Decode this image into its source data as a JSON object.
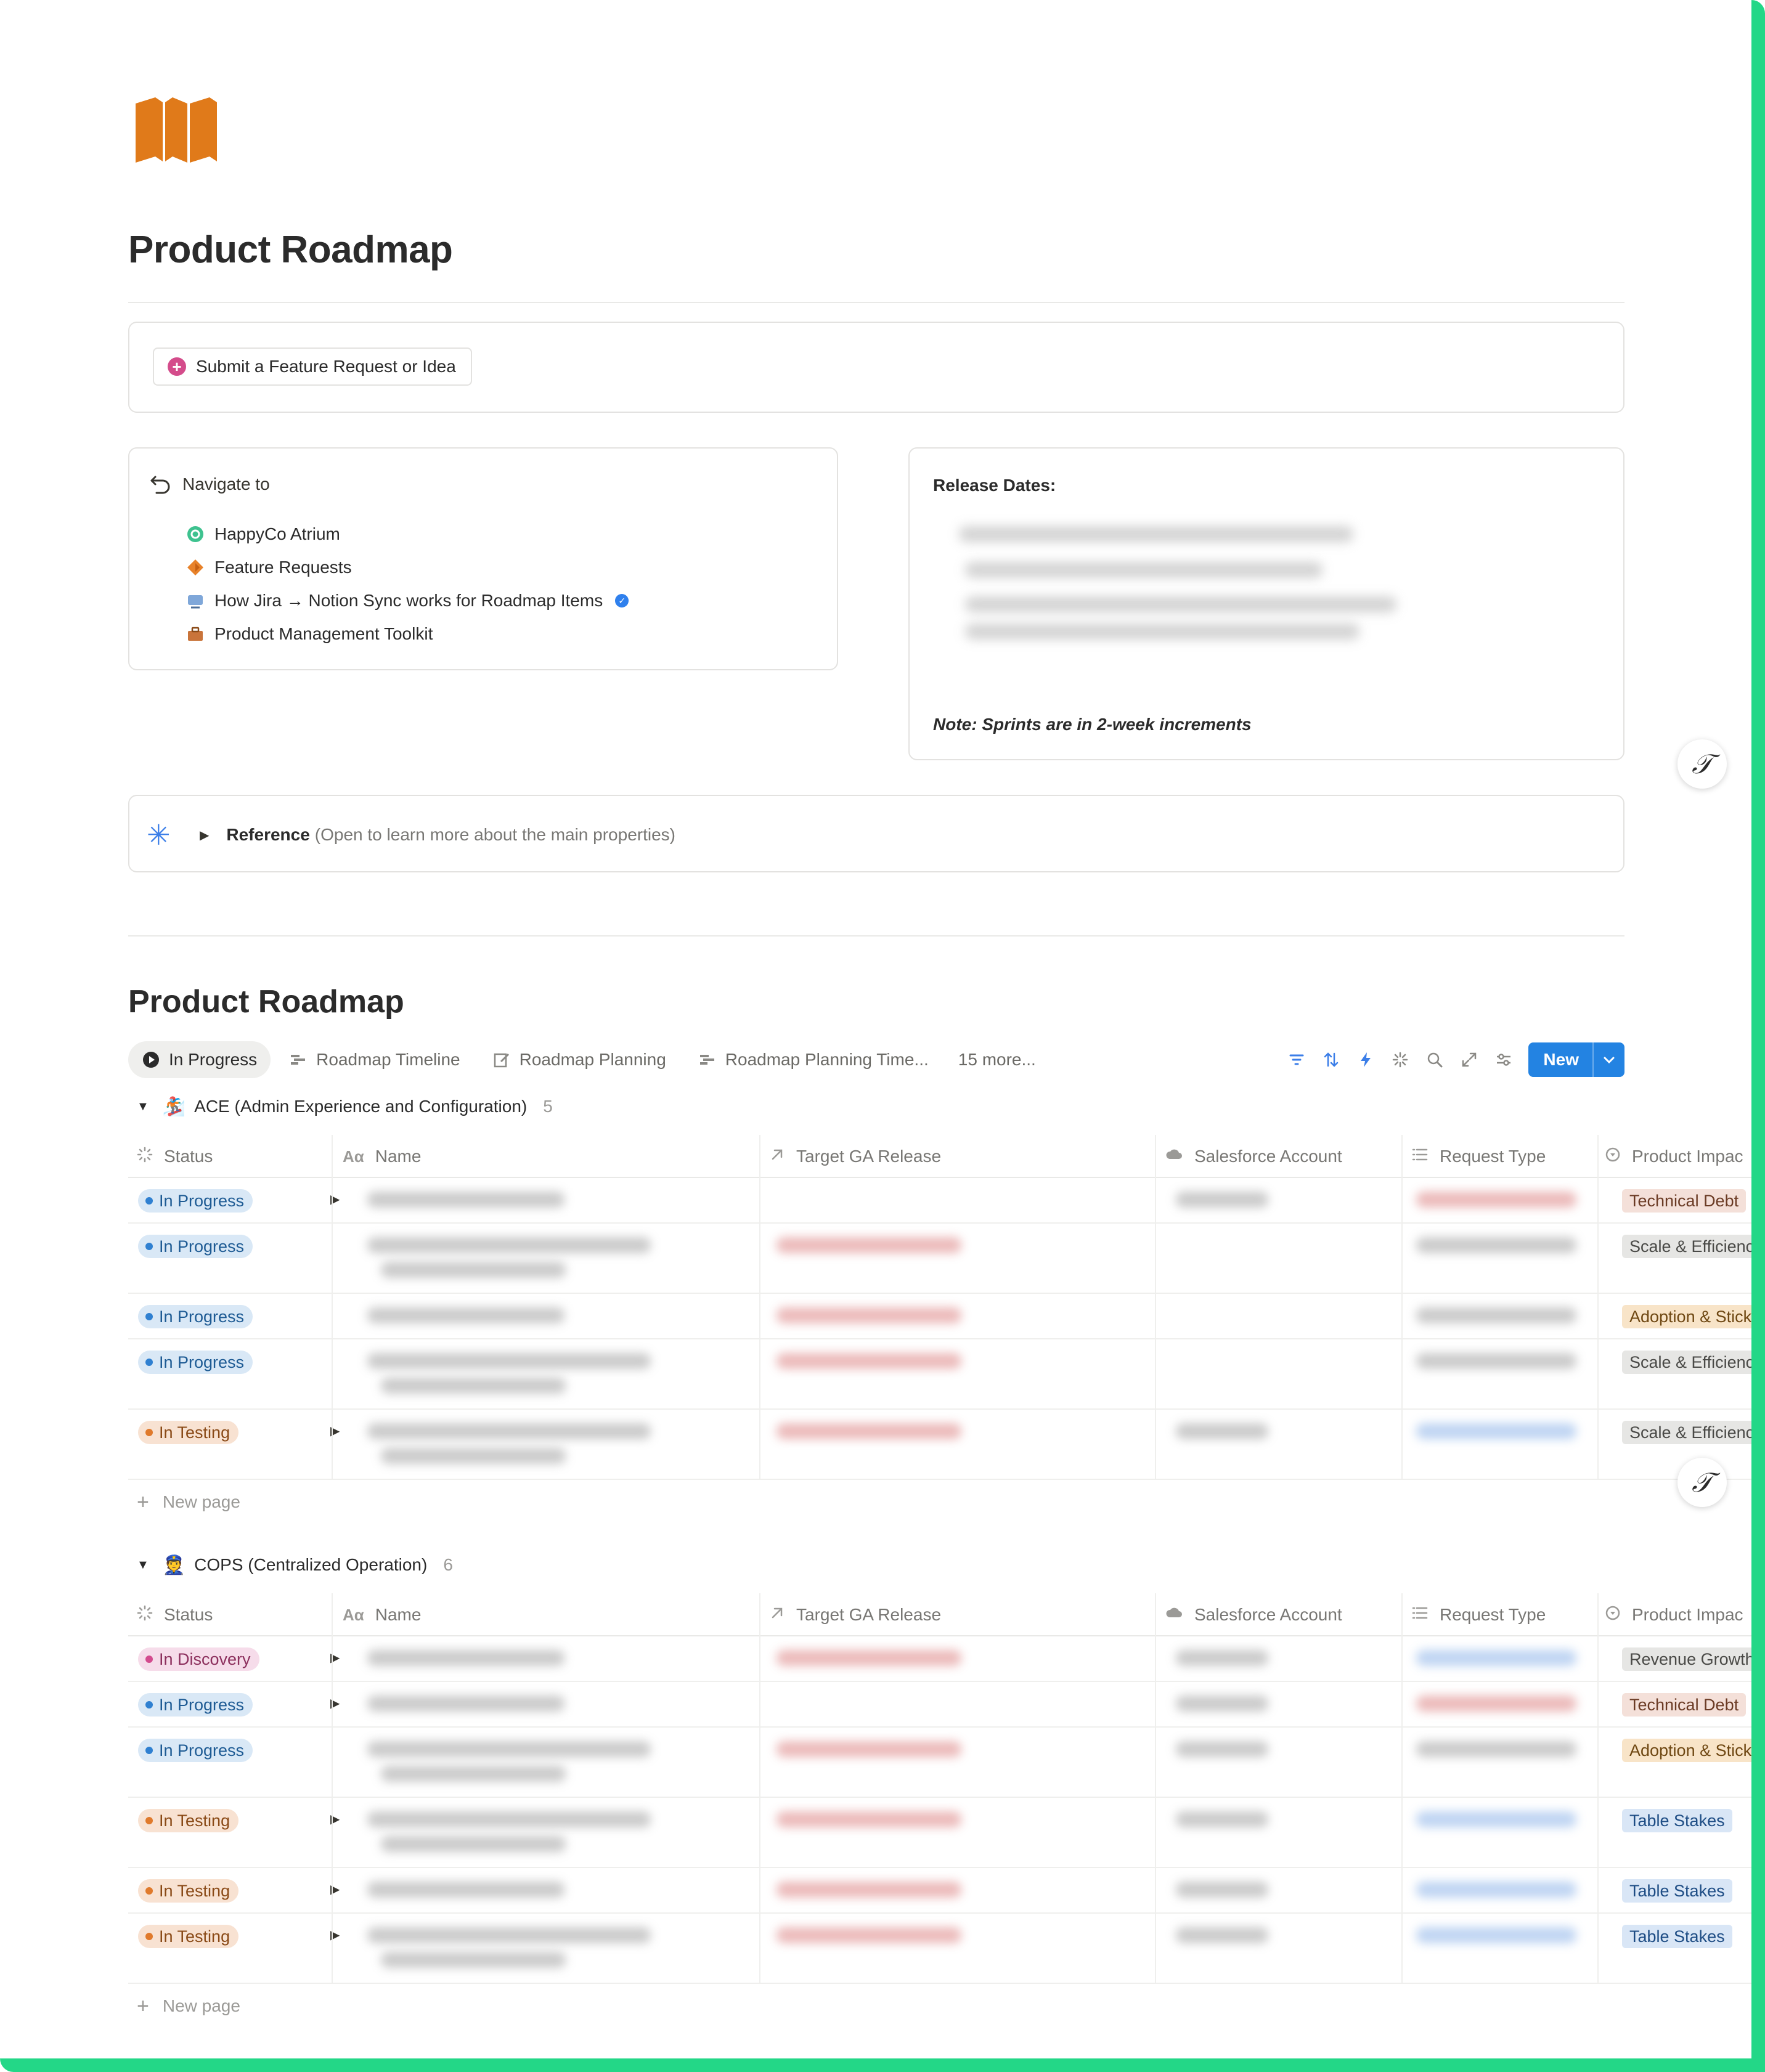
{
  "page": {
    "title": "Product Roadmap"
  },
  "submit_button": {
    "label": "Submit a Feature Request or Idea"
  },
  "navigate": {
    "heading": "Navigate to",
    "items": [
      {
        "label": "HappyCo Atrium",
        "icon": "atrium-icon"
      },
      {
        "label": "Feature Requests",
        "icon": "feature-requests-icon"
      },
      {
        "label": "How Jira → Notion Sync works for Roadmap Items",
        "icon": "sync-icon",
        "verified": true
      },
      {
        "label": "Product Management Toolkit",
        "icon": "toolkit-icon"
      }
    ]
  },
  "release": {
    "title": "Release Dates:",
    "note": "Note: Sprints are in 2-week increments"
  },
  "reference": {
    "label": "Reference",
    "sub": "(Open to learn more about the main properties)"
  },
  "database": {
    "title": "Product Roadmap",
    "tabs": [
      {
        "label": "In Progress",
        "icon": "play-circle-icon",
        "active": true
      },
      {
        "label": "Roadmap Timeline",
        "icon": "timeline-icon",
        "active": false
      },
      {
        "label": "Roadmap Planning",
        "icon": "edit-icon",
        "active": false
      },
      {
        "label": "Roadmap Planning Time...",
        "icon": "timeline-icon",
        "active": false
      }
    ],
    "more_tabs": "15 more...",
    "new_label": "New",
    "columns": {
      "status": "Status",
      "name": "Name",
      "target": "Target GA Release",
      "account": "Salesforce Account",
      "request": "Request Type",
      "impact": "Product Impac"
    },
    "new_page": "New page",
    "groups": [
      {
        "emoji": "🏂",
        "name": "ACE (Admin Experience and Configuration)",
        "count": "5",
        "rows": [
          {
            "status": "In Progress",
            "kind": "prog",
            "impact": "Technical Debt",
            "impact_kind": "debt"
          },
          {
            "status": "In Progress",
            "kind": "prog",
            "impact": "Scale & Efficiency",
            "impact_kind": "scale"
          },
          {
            "status": "In Progress",
            "kind": "prog",
            "impact": "Adoption & Sticki",
            "impact_kind": "adopt"
          },
          {
            "status": "In Progress",
            "kind": "prog",
            "impact": "Scale & Efficiency",
            "impact_kind": "scale"
          },
          {
            "status": "In Testing",
            "kind": "test",
            "impact": "Scale & Efficiency",
            "impact_kind": "scale"
          }
        ]
      },
      {
        "emoji": "👮",
        "name": "COPS (Centralized Operation)",
        "count": "6",
        "rows": [
          {
            "status": "In Discovery",
            "kind": "disc",
            "impact": "Revenue Growth",
            "impact_kind": "revenue"
          },
          {
            "status": "In Progress",
            "kind": "prog",
            "impact": "Technical Debt",
            "impact_kind": "debt"
          },
          {
            "status": "In Progress",
            "kind": "prog",
            "impact": "Adoption & Sticki",
            "impact_kind": "adopt"
          },
          {
            "status": "In Testing",
            "kind": "test",
            "impact": "Table Stakes",
            "impact_kind": "stakes"
          },
          {
            "status": "In Testing",
            "kind": "test",
            "impact": "Table Stakes",
            "impact_kind": "stakes"
          },
          {
            "status": "In Testing",
            "kind": "test",
            "impact": "Table Stakes",
            "impact_kind": "stakes"
          }
        ]
      }
    ]
  },
  "colors": {
    "accent": "#2383e2",
    "frame": "#23d787",
    "logo": "#e07a1a"
  }
}
